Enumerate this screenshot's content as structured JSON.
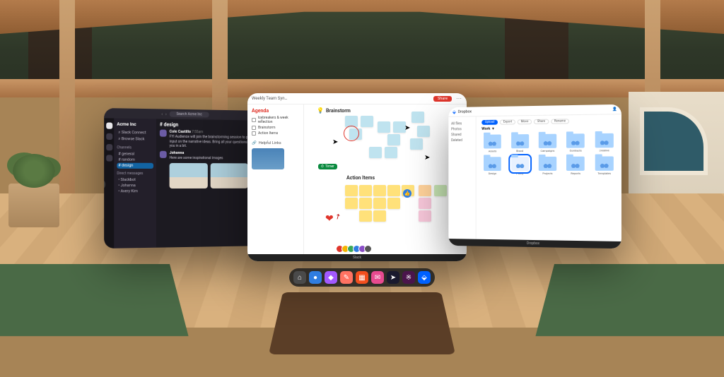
{
  "slack": {
    "workspace": "Acme Inc",
    "search_placeholder": "Search Acme Inc",
    "sections": {
      "top": [
        "Slack Connect",
        "Browse Slack"
      ],
      "channels_label": "Channels",
      "channels": [
        "general",
        "random",
        "design"
      ],
      "dms_label": "Direct messages",
      "dms": [
        "Slackbot",
        "Johanna",
        "Avery Kim"
      ]
    },
    "active_channel": "# design",
    "messages": [
      {
        "name": "Cole Castillo",
        "time": "7:55am",
        "text": "FYI Audience will join the brainstorming session to provide input on the narrative ideas. Bring all your questions! See you in a bit."
      },
      {
        "name": "Johanna",
        "time": "",
        "text": "Here are some inspirational images"
      }
    ]
  },
  "jam": {
    "doc_title": "Weekly Team Syn…",
    "share_label": "Share",
    "footer_label": "Slack",
    "agenda": {
      "heading": "Agenda",
      "items": [
        "Icebreakers & week reflection",
        "Brainstorm",
        "Action Items"
      ]
    },
    "links_heading": "Helpful Links",
    "brainstorm_heading": "Brainstorm",
    "action_items_heading": "Action Items",
    "timer_label": "Timer",
    "avatar_colors": [
      "#e0352b",
      "#f5b400",
      "#3aa757",
      "#2f7de1",
      "#8a4ec7",
      "#555"
    ]
  },
  "dropbox": {
    "brand": "Dropbox",
    "nav": [
      "All files",
      "Photos",
      "Shared",
      "Deleted"
    ],
    "chips": [
      "Upload",
      "Export",
      "Move",
      "Share",
      "Rename"
    ],
    "breadcrumb": "Work",
    "selected_index": 6,
    "folders": [
      "Assets",
      "Brand",
      "Campaigns",
      "Contracts",
      "Creative",
      "Design",
      "Policy",
      "Projects",
      "Reports",
      "Templates"
    ],
    "footer_label": "Dropbox"
  },
  "dock": {
    "apps": [
      {
        "name": "home",
        "color": "#4a4a4a",
        "glyph": "⌂"
      },
      {
        "name": "browser",
        "color": "#2f7de1",
        "glyph": "●"
      },
      {
        "name": "figma",
        "color": "#a259ff",
        "glyph": "◆"
      },
      {
        "name": "notes",
        "color": "#ff7262",
        "glyph": "✎"
      },
      {
        "name": "sticky",
        "color": "#f24e1e",
        "glyph": "▦"
      },
      {
        "name": "mail",
        "color": "#e84a8f",
        "glyph": "✉"
      },
      {
        "name": "pointer",
        "color": "#1a1a2e",
        "glyph": "➤"
      },
      {
        "name": "slack",
        "color": "#4a154b",
        "glyph": "※"
      },
      {
        "name": "dropbox",
        "color": "#0061fe",
        "glyph": "⬙"
      }
    ]
  }
}
